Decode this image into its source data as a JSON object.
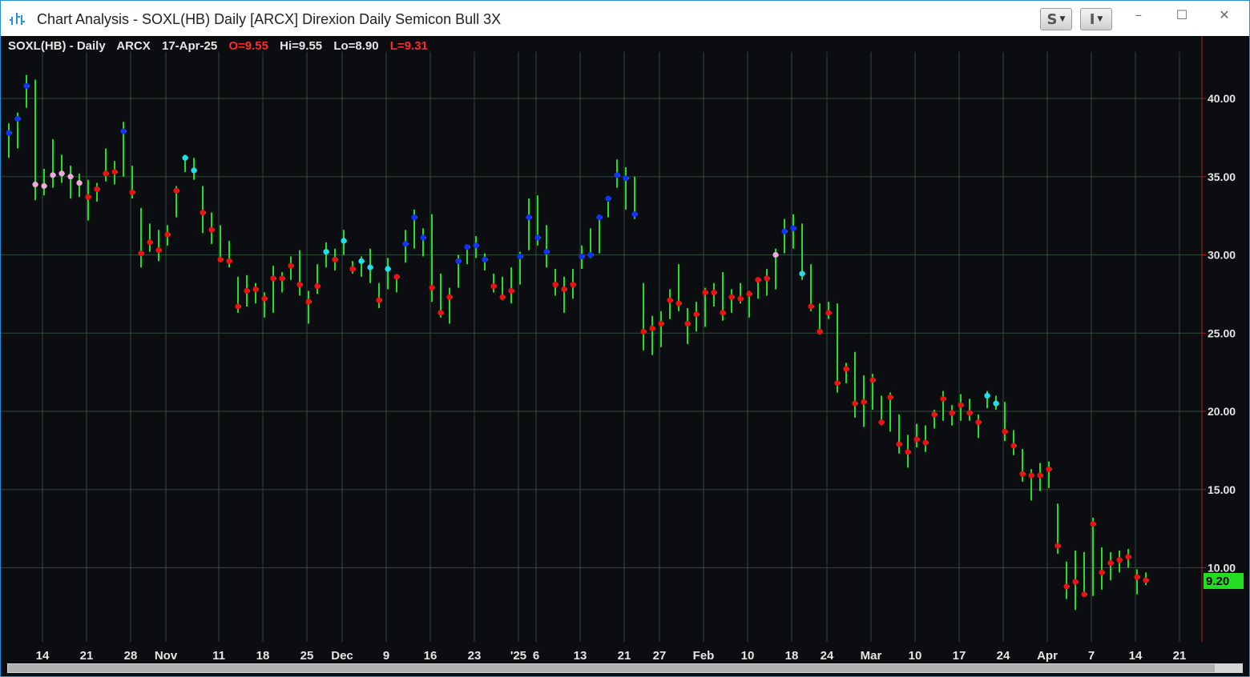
{
  "window": {
    "title": "Chart Analysis - SOXL(HB) Daily [ARCX] Direxion Daily Semicon Bull 3X",
    "buttons": [
      {
        "label": "S"
      },
      {
        "label": "I"
      }
    ],
    "controls": {
      "minimize": "–",
      "maximize": "☐",
      "close": "✕"
    }
  },
  "colors": {
    "background": "#0c0d10",
    "grid": "#2f4a3c",
    "bar": "#22dd22",
    "price_axis_line": "#aa2222",
    "last_price_badge": "#22dd22",
    "dot_red": "#ee1111",
    "dot_blue": "#1133ff",
    "dot_cyan": "#22ddee",
    "dot_pink": "#f0a8e0"
  },
  "header": {
    "symbol": "SOXL(HB) - Daily",
    "exchange": "ARCX",
    "date": "17-Apr-25",
    "open": "O=9.55",
    "high": "Hi=9.55",
    "low": "Lo=8.90",
    "last": "L=9.31"
  },
  "last_price_badge": "9.20",
  "chart_data": {
    "type": "ohlc_bars",
    "y_range": [
      5.0,
      44.0
    ],
    "y_ticks": [
      {
        "value": 10,
        "label": "10.00"
      },
      {
        "value": 15,
        "label": "15.00"
      },
      {
        "value": 20,
        "label": "20.00"
      },
      {
        "value": 25,
        "label": "25.00"
      },
      {
        "value": 30,
        "label": "30.00"
      },
      {
        "value": 35,
        "label": "35.00"
      },
      {
        "value": 40,
        "label": "40.00"
      }
    ],
    "x_ticks": [
      {
        "index": 2,
        "label": "14"
      },
      {
        "index": 7,
        "label": "21"
      },
      {
        "index": 12,
        "label": "28"
      },
      {
        "index": 16,
        "label": "Nov"
      },
      {
        "index": 22,
        "label": "11"
      },
      {
        "index": 27,
        "label": "18"
      },
      {
        "index": 32,
        "label": "25"
      },
      {
        "index": 36,
        "label": "Dec"
      },
      {
        "index": 41,
        "label": "9"
      },
      {
        "index": 46,
        "label": "16"
      },
      {
        "index": 51,
        "label": "23"
      },
      {
        "index": 56,
        "label": "'25"
      },
      {
        "index": 58,
        "label": "6"
      },
      {
        "index": 63,
        "label": "13"
      },
      {
        "index": 68,
        "label": "21"
      },
      {
        "index": 72,
        "label": "27"
      },
      {
        "index": 77,
        "label": "Feb"
      },
      {
        "index": 82,
        "label": "10"
      },
      {
        "index": 87,
        "label": "18"
      },
      {
        "index": 91,
        "label": "24"
      },
      {
        "index": 96,
        "label": "Mar"
      },
      {
        "index": 101,
        "label": "10"
      },
      {
        "index": 106,
        "label": "17"
      },
      {
        "index": 111,
        "label": "24"
      },
      {
        "index": 116,
        "label": "Apr"
      },
      {
        "index": 121,
        "label": "7"
      },
      {
        "index": 126,
        "label": "14"
      },
      {
        "index": 131,
        "label": "21"
      }
    ],
    "bars": [
      {
        "h": 38.4,
        "l": 36.2,
        "c": 37.8,
        "dot": "blue"
      },
      {
        "h": 39.1,
        "l": 36.8,
        "c": 38.7,
        "dot": "blue"
      },
      {
        "h": 41.5,
        "l": 39.4,
        "c": 40.8,
        "dot": "blue"
      },
      {
        "h": 41.2,
        "l": 33.5,
        "c": 34.5,
        "dot": "pink"
      },
      {
        "h": 35.5,
        "l": 33.8,
        "c": 34.4,
        "dot": "pink"
      },
      {
        "h": 37.4,
        "l": 34.3,
        "c": 35.1,
        "dot": "pink"
      },
      {
        "h": 36.4,
        "l": 34.6,
        "c": 35.2,
        "dot": "pink"
      },
      {
        "h": 35.7,
        "l": 33.6,
        "c": 35.0,
        "dot": "pink"
      },
      {
        "h": 35.2,
        "l": 33.7,
        "c": 34.6,
        "dot": "pink"
      },
      {
        "h": 34.8,
        "l": 32.2,
        "c": 33.7,
        "dot": "red"
      },
      {
        "h": 34.6,
        "l": 33.4,
        "c": 34.2,
        "dot": "red"
      },
      {
        "h": 36.8,
        "l": 34.7,
        "c": 35.2,
        "dot": "red"
      },
      {
        "h": 36.0,
        "l": 34.5,
        "c": 35.3,
        "dot": "red"
      },
      {
        "h": 38.5,
        "l": 35.0,
        "c": 37.9,
        "dot": "blue"
      },
      {
        "h": 35.7,
        "l": 33.6,
        "c": 34.0,
        "dot": "red"
      },
      {
        "h": 33.0,
        "l": 29.2,
        "c": 30.1,
        "dot": "red"
      },
      {
        "h": 32.0,
        "l": 30.2,
        "c": 30.8,
        "dot": "red"
      },
      {
        "h": 31.6,
        "l": 29.6,
        "c": 30.3,
        "dot": "red"
      },
      {
        "h": 31.9,
        "l": 30.6,
        "c": 31.3,
        "dot": "red"
      },
      {
        "h": 34.4,
        "l": 32.4,
        "c": 34.1,
        "dot": "red"
      },
      {
        "h": 36.4,
        "l": 35.3,
        "c": 36.2,
        "dot": "cyan"
      },
      {
        "h": 36.2,
        "l": 34.8,
        "c": 35.4,
        "dot": "cyan"
      },
      {
        "h": 34.4,
        "l": 31.4,
        "c": 32.7,
        "dot": "red"
      },
      {
        "h": 32.7,
        "l": 30.7,
        "c": 31.6,
        "dot": "red"
      },
      {
        "h": 31.9,
        "l": 29.6,
        "c": 29.7,
        "dot": "red"
      },
      {
        "h": 30.9,
        "l": 29.2,
        "c": 29.6,
        "dot": "red"
      },
      {
        "h": 28.6,
        "l": 26.3,
        "c": 26.7,
        "dot": "red"
      },
      {
        "h": 28.7,
        "l": 26.7,
        "c": 27.7,
        "dot": "red"
      },
      {
        "h": 28.2,
        "l": 26.9,
        "c": 27.8,
        "dot": "red"
      },
      {
        "h": 27.6,
        "l": 26.0,
        "c": 27.2,
        "dot": "red"
      },
      {
        "h": 29.3,
        "l": 26.3,
        "c": 28.5,
        "dot": "red"
      },
      {
        "h": 28.9,
        "l": 27.6,
        "c": 28.5,
        "dot": "red"
      },
      {
        "h": 29.9,
        "l": 28.4,
        "c": 29.3,
        "dot": "red"
      },
      {
        "h": 30.3,
        "l": 27.4,
        "c": 28.1,
        "dot": "red"
      },
      {
        "h": 27.7,
        "l": 25.6,
        "c": 27.0,
        "dot": "red"
      },
      {
        "h": 29.4,
        "l": 27.5,
        "c": 28.0,
        "dot": "red"
      },
      {
        "h": 30.8,
        "l": 29.2,
        "c": 30.2,
        "dot": "cyan"
      },
      {
        "h": 30.4,
        "l": 29.0,
        "c": 29.7,
        "dot": "red"
      },
      {
        "h": 31.6,
        "l": 30.0,
        "c": 30.9,
        "dot": "cyan"
      },
      {
        "h": 29.6,
        "l": 28.8,
        "c": 29.1,
        "dot": "red"
      },
      {
        "h": 29.9,
        "l": 28.6,
        "c": 29.6,
        "dot": "cyan"
      },
      {
        "h": 30.4,
        "l": 28.2,
        "c": 29.2,
        "dot": "cyan"
      },
      {
        "h": 28.2,
        "l": 26.6,
        "c": 27.1,
        "dot": "red"
      },
      {
        "h": 29.8,
        "l": 27.8,
        "c": 29.1,
        "dot": "cyan"
      },
      {
        "h": 28.7,
        "l": 27.6,
        "c": 28.6,
        "dot": "red"
      },
      {
        "h": 31.6,
        "l": 29.5,
        "c": 30.7,
        "dot": "blue"
      },
      {
        "h": 32.9,
        "l": 30.4,
        "c": 32.4,
        "dot": "blue"
      },
      {
        "h": 31.7,
        "l": 29.9,
        "c": 31.1,
        "dot": "blue"
      },
      {
        "h": 32.6,
        "l": 27.0,
        "c": 27.9,
        "dot": "red"
      },
      {
        "h": 28.8,
        "l": 26.0,
        "c": 26.3,
        "dot": "red"
      },
      {
        "h": 27.9,
        "l": 25.6,
        "c": 27.3,
        "dot": "red"
      },
      {
        "h": 30.0,
        "l": 27.9,
        "c": 29.6,
        "dot": "blue"
      },
      {
        "h": 30.6,
        "l": 29.4,
        "c": 30.5,
        "dot": "blue"
      },
      {
        "h": 31.2,
        "l": 29.8,
        "c": 30.6,
        "dot": "blue"
      },
      {
        "h": 30.1,
        "l": 29.0,
        "c": 29.7,
        "dot": "blue"
      },
      {
        "h": 28.8,
        "l": 27.6,
        "c": 28.0,
        "dot": "red"
      },
      {
        "h": 28.6,
        "l": 27.1,
        "c": 27.3,
        "dot": "red"
      },
      {
        "h": 29.2,
        "l": 26.9,
        "c": 27.7,
        "dot": "red"
      },
      {
        "h": 30.2,
        "l": 28.1,
        "c": 29.9,
        "dot": "blue"
      },
      {
        "h": 33.6,
        "l": 30.3,
        "c": 32.4,
        "dot": "blue"
      },
      {
        "h": 33.8,
        "l": 30.6,
        "c": 31.1,
        "dot": "blue"
      },
      {
        "h": 31.9,
        "l": 29.2,
        "c": 30.2,
        "dot": "blue"
      },
      {
        "h": 29.1,
        "l": 27.4,
        "c": 28.1,
        "dot": "red"
      },
      {
        "h": 28.6,
        "l": 26.3,
        "c": 27.8,
        "dot": "red"
      },
      {
        "h": 29.1,
        "l": 27.2,
        "c": 28.1,
        "dot": "red"
      },
      {
        "h": 30.6,
        "l": 29.1,
        "c": 29.9,
        "dot": "blue"
      },
      {
        "h": 31.7,
        "l": 29.8,
        "c": 30.0,
        "dot": "blue"
      },
      {
        "h": 32.3,
        "l": 30.1,
        "c": 32.4,
        "dot": "blue"
      },
      {
        "h": 33.4,
        "l": 32.4,
        "c": 33.6,
        "dot": "blue"
      },
      {
        "h": 36.1,
        "l": 34.3,
        "c": 35.1,
        "dot": "blue"
      },
      {
        "h": 35.6,
        "l": 32.9,
        "c": 34.9,
        "dot": "blue"
      },
      {
        "h": 35.0,
        "l": 32.3,
        "c": 32.6,
        "dot": "blue"
      },
      {
        "h": 28.2,
        "l": 23.9,
        "c": 25.1,
        "dot": "red"
      },
      {
        "h": 26.1,
        "l": 23.6,
        "c": 25.3,
        "dot": "red"
      },
      {
        "h": 26.4,
        "l": 24.1,
        "c": 25.6,
        "dot": "red"
      },
      {
        "h": 27.8,
        "l": 25.9,
        "c": 27.1,
        "dot": "red"
      },
      {
        "h": 29.4,
        "l": 26.4,
        "c": 26.9,
        "dot": "red"
      },
      {
        "h": 26.6,
        "l": 24.3,
        "c": 25.6,
        "dot": "red"
      },
      {
        "h": 27.0,
        "l": 25.1,
        "c": 26.2,
        "dot": "red"
      },
      {
        "h": 27.9,
        "l": 25.4,
        "c": 27.6,
        "dot": "red"
      },
      {
        "h": 28.2,
        "l": 26.7,
        "c": 27.6,
        "dot": "red"
      },
      {
        "h": 28.9,
        "l": 25.8,
        "c": 26.3,
        "dot": "red"
      },
      {
        "h": 27.8,
        "l": 26.3,
        "c": 27.3,
        "dot": "red"
      },
      {
        "h": 28.2,
        "l": 26.9,
        "c": 27.2,
        "dot": "red"
      },
      {
        "h": 27.7,
        "l": 26.0,
        "c": 27.5,
        "dot": "red"
      },
      {
        "h": 28.5,
        "l": 27.2,
        "c": 28.4,
        "dot": "red"
      },
      {
        "h": 29.1,
        "l": 27.4,
        "c": 28.5,
        "dot": "red"
      },
      {
        "h": 30.4,
        "l": 27.8,
        "c": 30.0,
        "dot": "pink"
      },
      {
        "h": 32.3,
        "l": 30.1,
        "c": 31.5,
        "dot": "blue"
      },
      {
        "h": 32.6,
        "l": 30.4,
        "c": 31.7,
        "dot": "blue"
      },
      {
        "h": 32.0,
        "l": 28.4,
        "c": 28.8,
        "dot": "cyan"
      },
      {
        "h": 29.4,
        "l": 26.4,
        "c": 26.7,
        "dot": "red"
      },
      {
        "h": 26.9,
        "l": 24.9,
        "c": 25.1,
        "dot": "red"
      },
      {
        "h": 27.0,
        "l": 25.9,
        "c": 26.3,
        "dot": "red"
      },
      {
        "h": 26.9,
        "l": 21.2,
        "c": 21.8,
        "dot": "red"
      },
      {
        "h": 23.1,
        "l": 21.8,
        "c": 22.7,
        "dot": "red"
      },
      {
        "h": 23.8,
        "l": 19.6,
        "c": 20.5,
        "dot": "red"
      },
      {
        "h": 22.3,
        "l": 19.0,
        "c": 20.6,
        "dot": "red"
      },
      {
        "h": 22.4,
        "l": 20.1,
        "c": 22.0,
        "dot": "red"
      },
      {
        "h": 21.0,
        "l": 19.1,
        "c": 19.3,
        "dot": "red"
      },
      {
        "h": 21.2,
        "l": 18.7,
        "c": 20.9,
        "dot": "red"
      },
      {
        "h": 19.8,
        "l": 17.3,
        "c": 17.9,
        "dot": "red"
      },
      {
        "h": 18.5,
        "l": 16.4,
        "c": 17.4,
        "dot": "red"
      },
      {
        "h": 19.2,
        "l": 17.7,
        "c": 18.2,
        "dot": "red"
      },
      {
        "h": 19.1,
        "l": 17.4,
        "c": 18.0,
        "dot": "red"
      },
      {
        "h": 20.1,
        "l": 18.9,
        "c": 19.8,
        "dot": "red"
      },
      {
        "h": 21.3,
        "l": 19.4,
        "c": 20.8,
        "dot": "red"
      },
      {
        "h": 20.4,
        "l": 19.1,
        "c": 19.9,
        "dot": "red"
      },
      {
        "h": 21.1,
        "l": 19.4,
        "c": 20.4,
        "dot": "red"
      },
      {
        "h": 20.8,
        "l": 19.4,
        "c": 19.9,
        "dot": "red"
      },
      {
        "h": 19.8,
        "l": 18.3,
        "c": 19.3,
        "dot": "red"
      },
      {
        "h": 21.3,
        "l": 20.2,
        "c": 21.0,
        "dot": "cyan"
      },
      {
        "h": 21.0,
        "l": 20.1,
        "c": 20.5,
        "dot": "cyan"
      },
      {
        "h": 20.6,
        "l": 18.1,
        "c": 18.7,
        "dot": "red"
      },
      {
        "h": 18.8,
        "l": 17.2,
        "c": 17.8,
        "dot": "red"
      },
      {
        "h": 17.6,
        "l": 15.5,
        "c": 16.0,
        "dot": "red"
      },
      {
        "h": 16.3,
        "l": 14.3,
        "c": 15.9,
        "dot": "red"
      },
      {
        "h": 16.7,
        "l": 14.9,
        "c": 15.9,
        "dot": "red"
      },
      {
        "h": 16.8,
        "l": 15.1,
        "c": 16.3,
        "dot": "red"
      },
      {
        "h": 14.1,
        "l": 10.9,
        "c": 11.4,
        "dot": "red"
      },
      {
        "h": 10.4,
        "l": 8.0,
        "c": 8.8,
        "dot": "red"
      },
      {
        "h": 11.1,
        "l": 7.3,
        "c": 9.1,
        "dot": "red"
      },
      {
        "h": 11.0,
        "l": 8.2,
        "c": 8.3,
        "dot": "red"
      },
      {
        "h": 13.2,
        "l": 8.2,
        "c": 12.8,
        "dot": "red"
      },
      {
        "h": 11.3,
        "l": 8.6,
        "c": 9.7,
        "dot": "red"
      },
      {
        "h": 11.0,
        "l": 9.2,
        "c": 10.3,
        "dot": "red"
      },
      {
        "h": 11.1,
        "l": 9.7,
        "c": 10.5,
        "dot": "red"
      },
      {
        "h": 11.2,
        "l": 10.0,
        "c": 10.7,
        "dot": "red"
      },
      {
        "h": 9.9,
        "l": 8.3,
        "c": 9.4,
        "dot": "red"
      },
      {
        "h": 9.7,
        "l": 8.9,
        "c": 9.2,
        "dot": "red"
      }
    ]
  }
}
